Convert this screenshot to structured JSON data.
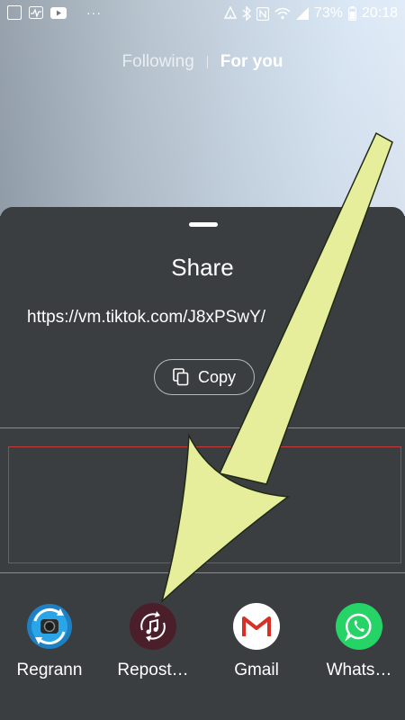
{
  "status_bar": {
    "left_icons": [
      "image-icon",
      "pulse-icon",
      "youtube-icon"
    ],
    "overflow": "···",
    "right_icons": [
      "vibrate-icon",
      "bluetooth-icon",
      "nfc-icon",
      "wifi-icon",
      "signal-icon"
    ],
    "battery": "73%",
    "time": "20:18"
  },
  "feed_tabs": {
    "following": "Following",
    "for_you": "For you"
  },
  "share_sheet": {
    "title": "Share",
    "url": "https://vm.tiktok.com/J8xPSwY/",
    "copy_label": "Copy",
    "apps": [
      {
        "label": "Regrann",
        "icon": "regrann-icon",
        "color": "#2b9bd6"
      },
      {
        "label": "Repost…",
        "icon": "repost-icon",
        "color": "#4a1f2a"
      },
      {
        "label": "Gmail",
        "icon": "gmail-icon",
        "color": "#ffffff"
      },
      {
        "label": "Whats…",
        "icon": "whatsapp-icon",
        "color": "#25d366"
      }
    ]
  },
  "annotation": {
    "arrow_color": "#e6ee9c",
    "highlight_box_color": "#c33a3a"
  }
}
